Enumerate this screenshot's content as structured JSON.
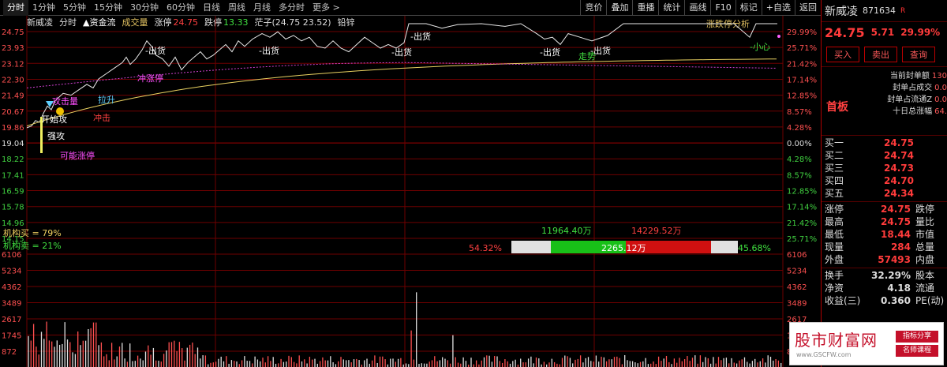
{
  "toolbar": {
    "tabs": [
      "分时",
      "1分钟",
      "5分钟",
      "15分钟",
      "30分钟",
      "60分钟",
      "日线",
      "周线",
      "月线",
      "多分时",
      "更多 >"
    ],
    "active_tab": 0,
    "right_buttons": [
      "竞价",
      "叠加",
      "重播",
      "统计",
      "画线",
      "F10",
      "标记",
      "+自选",
      "返回"
    ]
  },
  "legend": {
    "name": "新威凌",
    "time": "分时",
    "fund_flow": "▲资金流",
    "volume": "成交量",
    "limit_up_label": "涨停",
    "limit_up": "24.75",
    "limit_down_label": "跌停",
    "limit_down": "13.33",
    "bigyi": "茫子(24.75 23.52)",
    "lead": "铅锌",
    "analysis": "涨跌停分析"
  },
  "annotations": {
    "attack": "攻击量",
    "pull": "拉升",
    "start": "开始攻",
    "shoot": "冲击",
    "strong": "强攻",
    "maybe_limit": "可能涨停",
    "limit_stop": "冲涨停",
    "sell1": "出货",
    "sell2": "出货",
    "sell3": "出货",
    "sell4": "出货",
    "sell5": "出货",
    "sell6": "出货",
    "careful": "小心",
    "flee": "走势",
    "inst_buy": "机构买 = 79%",
    "inst_sell": "机构卖 = 21%",
    "buy_pct": "54.32%",
    "sell_pct": "45.68%",
    "buy_amt": "11964.40万",
    "sell_amt": "14229.52万",
    "mid_amt": "2265.12万"
  },
  "chart_data": {
    "type": "line",
    "price_axis_left": [
      "24.75",
      "23.93",
      "23.12",
      "22.30",
      "21.49",
      "20.67",
      "19.86",
      "19.04",
      "18.22",
      "17.41",
      "16.59",
      "15.78",
      "14.96",
      "14.15"
    ],
    "price_axis_right": [
      "29.99%",
      "25.71%",
      "21.42%",
      "17.14%",
      "12.85%",
      "8.57%",
      "4.28%",
      "0.00%",
      "4.28%",
      "8.57%",
      "12.85%",
      "17.14%",
      "21.42%",
      "25.71%"
    ],
    "volume_axis_left": [
      "6106",
      "5234",
      "4362",
      "3489",
      "2617",
      "1745",
      "872"
    ],
    "volume_axis_right": [
      "6106",
      "5234",
      "4362",
      "3489",
      "2617",
      "1745",
      "872"
    ],
    "price_ylim": [
      13.33,
      24.75
    ],
    "volume_ylim": [
      0,
      6106
    ],
    "grid": true
  },
  "panel": {
    "name": "新威凌",
    "code": "871634",
    "flag": "R",
    "price": "24.75",
    "change": "5.71",
    "pct": "29.99%",
    "buttons": [
      "买入",
      "卖出",
      "查询"
    ],
    "board_label": "首板",
    "board_stats": [
      {
        "label": "当前封单额",
        "value": "130"
      },
      {
        "label": "封单占成交",
        "value": "0.0"
      },
      {
        "label": "封单占流通Z",
        "value": "0.0"
      },
      {
        "label": "十日总涨幅",
        "value": "64."
      }
    ],
    "bids": [
      {
        "label": "买一",
        "price": "24.75"
      },
      {
        "label": "买二",
        "price": "24.74"
      },
      {
        "label": "买三",
        "price": "24.73"
      },
      {
        "label": "买四",
        "price": "24.70"
      },
      {
        "label": "买五",
        "price": "24.34"
      }
    ],
    "stats1": [
      {
        "l": "涨停",
        "v": "24.75",
        "r": "跌停"
      },
      {
        "l": "最高",
        "v": "24.75",
        "r": "量比"
      },
      {
        "l": "最低",
        "v": "18.44",
        "r": "市值"
      },
      {
        "l": "现量",
        "v": "284",
        "r": "总量"
      },
      {
        "l": "外盘",
        "v": "57493",
        "r": "内盘"
      }
    ],
    "stats2": [
      {
        "l": "换手",
        "v": "32.29%",
        "r": "股本"
      },
      {
        "l": "净资",
        "v": "4.18",
        "r": "流通"
      },
      {
        "l": "收益(三)",
        "v": "0.360",
        "r": "PE(动)"
      }
    ]
  },
  "ad": {
    "title": "股市财富网",
    "url": "www.GSCFW.com",
    "tag1": "指标分享",
    "tag2": "名师课程"
  }
}
